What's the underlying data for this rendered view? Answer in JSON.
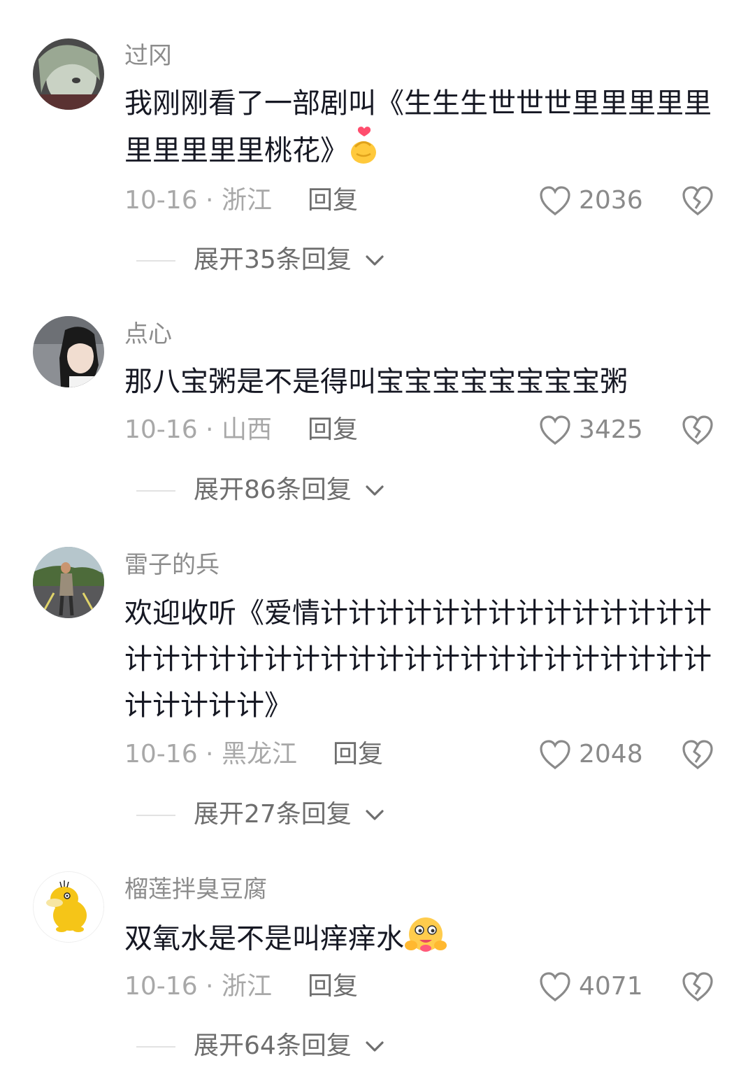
{
  "comments": [
    {
      "username": "过冈",
      "text": "我刚刚看了一部剧叫《生生生世世世里里里里里里里里里里桃花》",
      "emoji": "finger-heart-emoji",
      "date_location": "10-16 · 浙江",
      "reply_label": "回复",
      "likes": "2036",
      "expand_label": "展开35条回复"
    },
    {
      "username": "点心",
      "text": "那八宝粥是不是得叫宝宝宝宝宝宝宝宝粥",
      "date_location": "10-16 · 山西",
      "reply_label": "回复",
      "likes": "3425",
      "expand_label": "展开86条回复"
    },
    {
      "username": "雷子的兵",
      "text": "欢迎收听《爱情计计计计计计计计计计计计计计计计计计计计计计计计计计计计计计计计计计计计计计计计》",
      "date_location": "10-16 · 黑龙江",
      "reply_label": "回复",
      "likes": "2048",
      "expand_label": "展开27条回复"
    },
    {
      "username": "榴莲拌臭豆腐",
      "text": "双氧水是不是叫痒痒水",
      "emoji": "hugging-face-emoji",
      "date_location": "10-16 · 浙江",
      "reply_label": "回复",
      "likes": "4071",
      "expand_label": "展开64条回复"
    }
  ],
  "colors": {
    "text_primary": "#161823",
    "username": "#8c8c8c",
    "meta": "#a8a8a8",
    "reply": "#6e6e6e"
  }
}
